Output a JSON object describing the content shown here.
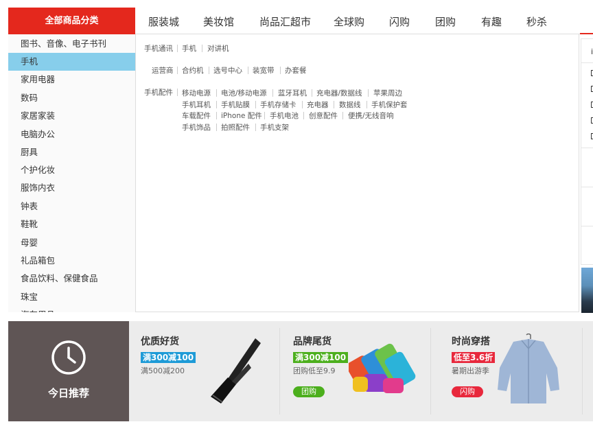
{
  "nav": {
    "category_button": "全部商品分类",
    "items": [
      "服装城",
      "美妆馆",
      "尚品汇超市",
      "全球购",
      "闪购",
      "团购",
      "有趣",
      "秒杀"
    ],
    "accent": "#e4281d"
  },
  "sidebar": {
    "items": [
      "图书、音像、电子书刊",
      "手机",
      "家用电器",
      "数码",
      "家居家装",
      "电脑办公",
      "厨具",
      "个护化妆",
      "服饰内衣",
      "钟表",
      "鞋靴",
      "母婴",
      "礼品箱包",
      "食品饮料、保健食品",
      "珠宝",
      "汽车用品"
    ],
    "active_index": 1,
    "active_color": "#87ceeb"
  },
  "flyout": {
    "groups": [
      {
        "title": "手机通讯",
        "rows": [
          [
            "手机",
            "对讲机"
          ]
        ]
      },
      {
        "title": "运营商",
        "rows": [
          [
            "合约机",
            "选号中心",
            "装宽带",
            "办套餐"
          ]
        ]
      },
      {
        "title": "手机配件",
        "rows": [
          [
            "移动电源",
            "电池/移动电源",
            "蓝牙耳机",
            "充电器/数据线",
            "苹果周边"
          ],
          [
            "手机耳机",
            "手机贴膜",
            "手机存储卡",
            "充电器",
            "数据线",
            "手机保护套"
          ],
          [
            "车载配件",
            "iPhone 配件",
            "手机电池",
            "创意配件",
            "便携/无线音响"
          ],
          [
            "手机饰品",
            "拍照配件",
            "手机支架"
          ]
        ]
      }
    ]
  },
  "right_panel": {
    "heading_char": "i"
  },
  "today": {
    "title": "今日推荐",
    "icon": "clock-icon",
    "cards": [
      {
        "title": "优质好货",
        "badge": "满300减100",
        "badge_color": "#1e9bd7",
        "sub": "满500减200",
        "button": "",
        "image": "handheld-vacuum-image"
      },
      {
        "title": "品牌尾货",
        "badge": "满300减100",
        "badge_color": "#4caf1d",
        "sub": "团购低至9.9",
        "button": "团购",
        "button_color": "#4caf1d",
        "image": "towels-image"
      },
      {
        "title": "时尚穿搭",
        "badge": "低至3.6折",
        "badge_color": "#e8283c",
        "sub": "暑期出游季",
        "button": "闪购",
        "button_color": "#e8283c",
        "image": "shirt-image"
      }
    ]
  }
}
